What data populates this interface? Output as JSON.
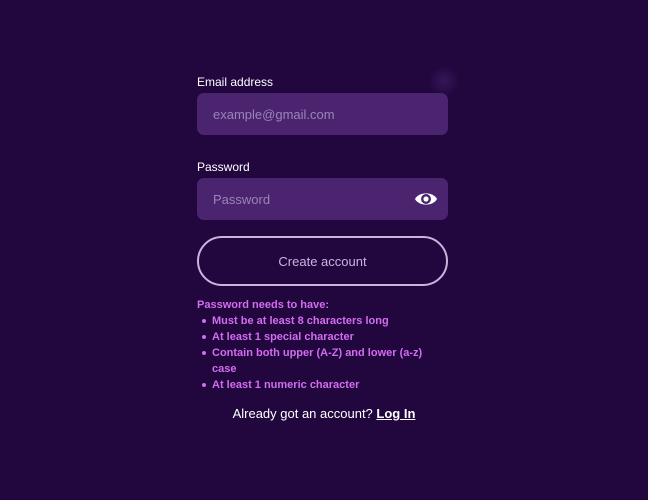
{
  "email": {
    "label": "Email address",
    "placeholder": "example@gmail.com",
    "value": ""
  },
  "password": {
    "label": "Password",
    "placeholder": "Password",
    "value": "",
    "toggle_icon": "eye-icon"
  },
  "create_button": {
    "label": "Create account"
  },
  "requirements": {
    "heading": "Password needs to have:",
    "items": [
      "Must be at least 8 characters long",
      "At least 1 special character",
      "Contain both upper (A-Z) and lower (a-z) case",
      "At least 1 numeric character"
    ]
  },
  "footer": {
    "text": "Already got an account?",
    "link": "Log In"
  },
  "colors": {
    "background": "#22073f",
    "input_bg": "#4b246f",
    "accent": "#d36cf0",
    "button_border": "#c9b4dc"
  }
}
